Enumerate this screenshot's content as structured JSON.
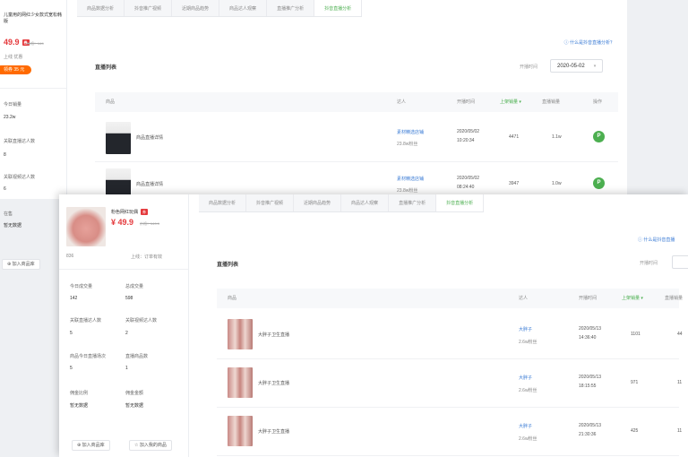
{
  "back_window": {
    "product": {
      "name": "儿童用的网红少女款式宽松韩版",
      "price": "49.9",
      "orig": "价格：¥49",
      "sub": "上线   优惠",
      "pill": "领券 35 元"
    },
    "stats": [
      {
        "label": "今日销量",
        "value": "23.2w"
      },
      {
        "label": "关联直播达人数",
        "value": "8"
      },
      {
        "label": "关联视频达人数",
        "value": "6"
      },
      {
        "label": "在售",
        "value": "暂无数据"
      }
    ],
    "add_button": "加入商品库",
    "tabs": [
      "商品数据分析",
      "抖音推广视频",
      "近期商品趋势",
      "商品达人观察",
      "直播推广分析",
      "抖音直播分析"
    ],
    "active_tab": 5,
    "top_link": "什么是抖音直播分析？",
    "section_title": "直播列表",
    "date_label": "开播时间",
    "date_value": "2020-05-02",
    "columns": [
      "商品",
      "达人",
      "开播时间",
      "上架销量",
      "直播销量",
      "操作"
    ],
    "rows": [
      {
        "title": "商品直播详情",
        "anchor": "素材精选店铺",
        "fans": "23.8w粉丝",
        "date": "2020/05/02",
        "time": "10:20:34",
        "sales": "4471",
        "gmv": "1.1w"
      },
      {
        "title": "商品直播详情",
        "anchor": "素材精选店铺",
        "fans": "23.8w粉丝",
        "date": "2020/05/02",
        "time": "08:24:40",
        "sales": "3947",
        "gmv": "1.0w"
      }
    ]
  },
  "front_window": {
    "product": {
      "name": "粉色网红玩偶",
      "price": "¥ 49.9",
      "orig": "价格：¥49.9",
      "left_info": "836",
      "right_info": "上线：订单有效"
    },
    "stats": [
      {
        "label": "今日成交量",
        "value": "142"
      },
      {
        "label": "总成交量",
        "value": "598"
      },
      {
        "label": "关联直播达人数",
        "value": "5"
      },
      {
        "label": "关联视频达人数",
        "value": "2"
      },
      {
        "label": "商品今日直播场次",
        "value": "5"
      },
      {
        "label": "直播商品数",
        "value": "1"
      },
      {
        "label": "佣金比例",
        "value": "暂无数据"
      },
      {
        "label": "佣金金额",
        "value": "暂无数据"
      }
    ],
    "btn_left": "加入商品库",
    "btn_right": "加入我的商品",
    "tabs": [
      "商品数据分析",
      "抖音推广视频",
      "近期商品趋势",
      "商品达人观察",
      "直播推广分析",
      "抖音直播分析"
    ],
    "active_tab": 5,
    "top_link": "什么是抖音直播",
    "section_title": "直播列表",
    "date_label": "开播时间",
    "columns": [
      "商品",
      "达人",
      "开播时间",
      "上架销量",
      "直播销量"
    ],
    "rows": [
      {
        "title": "大胖子卫生直播",
        "anchor": "大胖子",
        "fans": "2.6w粉丝",
        "date": "2020/05/13",
        "time": "14:36:40",
        "sales": "1101",
        "gmv": "44"
      },
      {
        "title": "大胖子卫生直播",
        "anchor": "大胖子",
        "fans": "2.6w粉丝",
        "date": "2020/05/13",
        "time": "18:15:55",
        "sales": "971",
        "gmv": "11"
      },
      {
        "title": "大胖子卫生直播",
        "anchor": "大胖子",
        "fans": "2.6w粉丝",
        "date": "2020/05/13",
        "time": "21:30:36",
        "sales": "425",
        "gmv": "11"
      }
    ]
  },
  "colors": {
    "green": "#4caf50",
    "link": "#3a7bd5",
    "price": "#e4393c",
    "orange": "#ff6a00"
  }
}
